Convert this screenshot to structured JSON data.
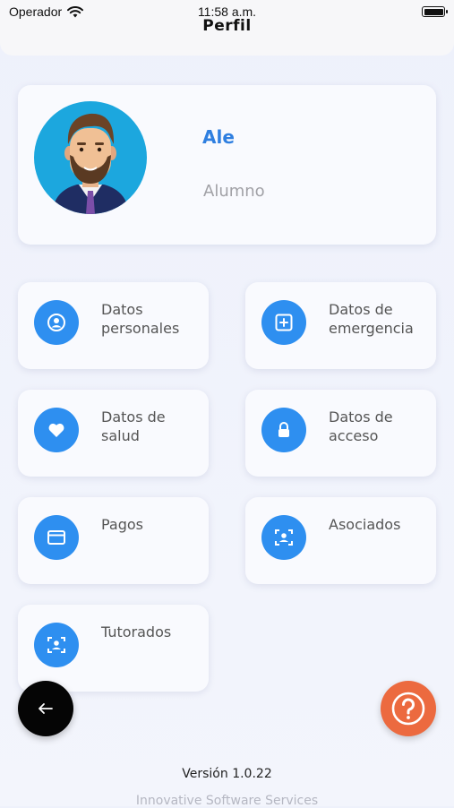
{
  "status_bar": {
    "carrier": "Operador",
    "time": "11:58 a.m.",
    "title": "Perfil"
  },
  "profile": {
    "name": "Ale",
    "role": "Alumno"
  },
  "menu": [
    {
      "label": "Datos personales",
      "icon": "user-circle-icon"
    },
    {
      "label": "Datos de emergencia",
      "icon": "first-aid-icon"
    },
    {
      "label": "Datos de salud",
      "icon": "heart-icon"
    },
    {
      "label": "Datos de acceso",
      "icon": "lock-icon"
    },
    {
      "label": "Pagos",
      "icon": "card-icon"
    },
    {
      "label": "Asociados",
      "icon": "user-scan-icon"
    },
    {
      "label": "Tutorados",
      "icon": "user-scan-icon"
    }
  ],
  "footer": {
    "version": "Versión 1.0.22",
    "company": "Innovative Software Services"
  },
  "colors": {
    "accent": "#2e8ff0",
    "name": "#2f7fe0",
    "help": "#ec6a3f",
    "back": "#050505"
  }
}
